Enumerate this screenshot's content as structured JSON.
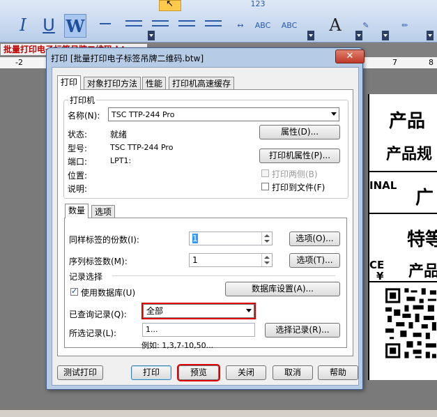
{
  "app": {
    "doc_tab": "批量打印电子标签吊牌二维码.btw",
    "ruler_numbers": [
      "-2",
      "7",
      "8"
    ],
    "toolbar": {
      "italic": "I",
      "underline": "U",
      "word_art": "W",
      "abc1": "ABC",
      "abc2": "ABC",
      "num": "123",
      "font_color": "A"
    },
    "label_preview": {
      "t1": "产品",
      "t2": "产品规",
      "t3": "INAL",
      "t4": "广",
      "t5": "特等",
      "t6": "产品",
      "t7": "CE",
      "t8": "¥"
    }
  },
  "dialog": {
    "title": "打印 [批量打印电子标签吊牌二维码.btw]",
    "close_glyph": "✕",
    "tabs": [
      "打印",
      "对象打印方法",
      "性能",
      "打印机高速缓存"
    ],
    "printer_group": {
      "legend": "打印机",
      "name_label": "名称(N):",
      "name_value": "TSC TTP-244 Pro",
      "status_label": "状态:",
      "status_value": "就绪",
      "model_label": "型号:",
      "model_value": "TSC TTP-244 Pro",
      "port_label": "端口:",
      "port_value": "LPT1:",
      "location_label": "位置:",
      "comment_label": "说明:",
      "properties_button": "属性(D)...",
      "printer_properties_button": "打印机属性(P)...",
      "print_both_sides": "打印两侧(B)",
      "print_to_file": "打印到文件(F)"
    },
    "sub_tabs": [
      "数量",
      "选项"
    ],
    "quantity": {
      "copies_label": "同样标签的份数(I):",
      "copies_value": "1",
      "copies_options_button": "选项(O)...",
      "serial_label": "序列标签数(M):",
      "serial_value": "1",
      "serial_options_button": "选项(T)...",
      "records_section": "记录选择",
      "use_database": "使用数据库(U)",
      "database_settings_button": "数据库设置(A)...",
      "queried_label": "已查询记录(Q):",
      "queried_value": "全部",
      "selected_label": "所选记录(L):",
      "selected_value": "1...",
      "select_records_button": "选择记录(R)...",
      "example": "例如:  1,3,7-10,50..."
    },
    "buttons": {
      "test_print": "测试打印",
      "print": "打印",
      "preview": "预览",
      "close": "关闭",
      "cancel": "取消",
      "help": "帮助"
    }
  }
}
